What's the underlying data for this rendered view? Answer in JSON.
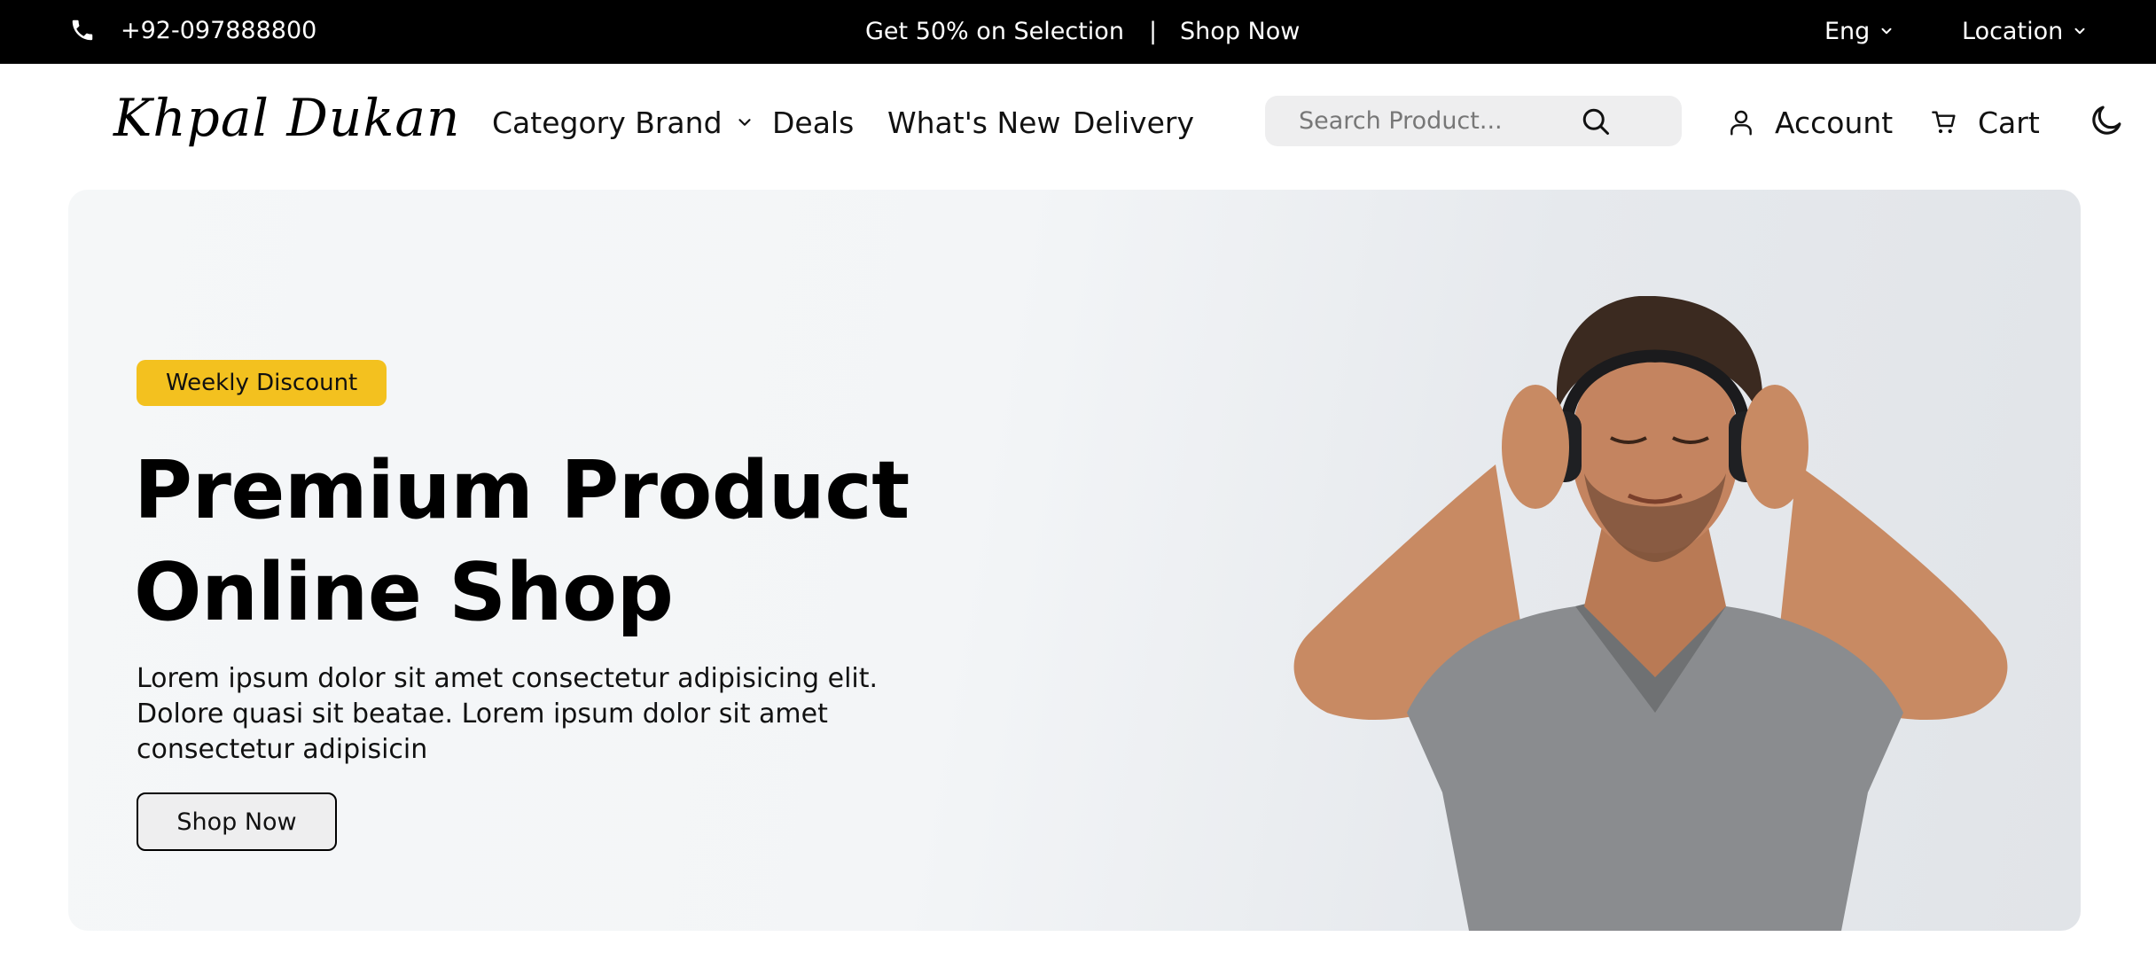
{
  "topbar": {
    "phone": "+92-097888800",
    "promo_text": "Get 50% on Selection",
    "promo_separator": "|",
    "promo_link": "Shop Now",
    "language": "Eng",
    "location": "Location",
    "icons": [
      "phone-icon",
      "chevron-down-icon"
    ]
  },
  "navbar": {
    "logo": "Khpal Dukan",
    "links": {
      "category": "Category Brand",
      "deals": "Deals",
      "whats_new": "What's New",
      "delivery": "Delivery"
    },
    "search_placeholder": "Search Product...",
    "account": "Account",
    "cart": "Cart",
    "icons": [
      "search-icon",
      "user-icon",
      "cart-icon",
      "moon-icon"
    ]
  },
  "hero": {
    "badge": "Weekly Discount",
    "title": "Premium Product Online Shop",
    "description": "Lorem ipsum dolor sit amet consectetur adipisicing elit. Dolore quasi sit beatae. Lorem ipsum dolor sit amet consectetur adipisicin",
    "button": "Shop Now",
    "image": "man-with-headphones"
  },
  "colors": {
    "topbar_bg": "#000000",
    "badge_bg": "#f3c11f",
    "hero_bg": "#f3f5f7",
    "search_bg": "#eeeeef"
  }
}
